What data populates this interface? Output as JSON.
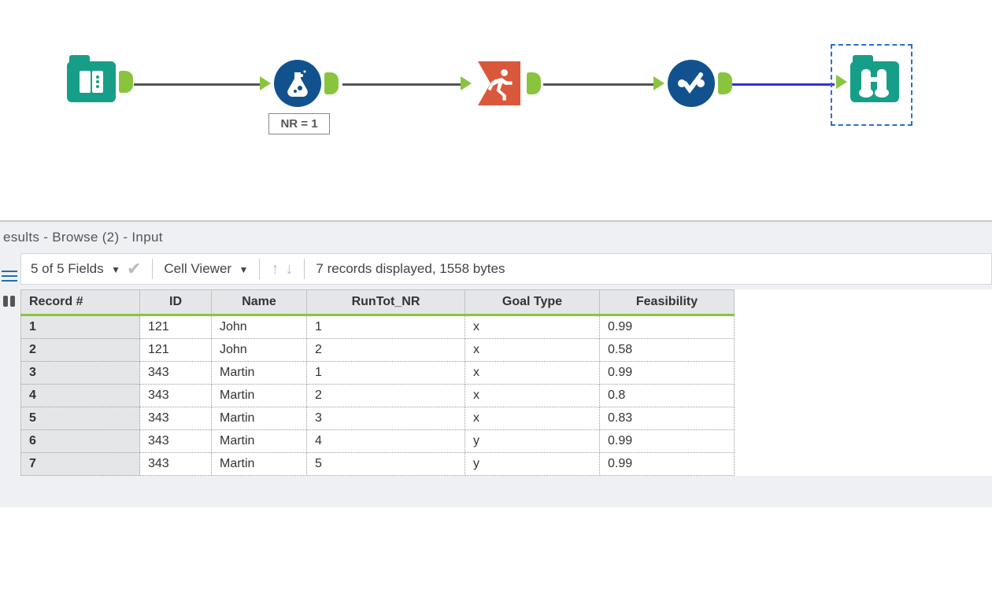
{
  "workflow": {
    "nodes": [
      {
        "name": "input-tool",
        "label": null
      },
      {
        "name": "formula-tool",
        "label": "NR = 1"
      },
      {
        "name": "running-total-tool",
        "label": null
      },
      {
        "name": "select-tool",
        "label": null
      },
      {
        "name": "browse-tool",
        "label": null
      }
    ]
  },
  "results": {
    "title": "esults - Browse (2) - Input",
    "toolbar": {
      "fields_label": "5 of 5 Fields",
      "cell_viewer_label": "Cell Viewer",
      "status": "7 records displayed, 1558 bytes"
    },
    "columns": [
      "Record #",
      "ID",
      "Name",
      "RunTot_NR",
      "Goal Type",
      "Feasibility"
    ],
    "rows": [
      {
        "rec": "1",
        "ID": "121",
        "Name": "John",
        "RunTot_NR": "1",
        "GoalType": "x",
        "Feasibility": "0.99"
      },
      {
        "rec": "2",
        "ID": "121",
        "Name": "John",
        "RunTot_NR": "2",
        "GoalType": "x",
        "Feasibility": "0.58"
      },
      {
        "rec": "3",
        "ID": "343",
        "Name": "Martin",
        "RunTot_NR": "1",
        "GoalType": "x",
        "Feasibility": "0.99"
      },
      {
        "rec": "4",
        "ID": "343",
        "Name": "Martin",
        "RunTot_NR": "2",
        "GoalType": "x",
        "Feasibility": "0.8"
      },
      {
        "rec": "5",
        "ID": "343",
        "Name": "Martin",
        "RunTot_NR": "3",
        "GoalType": "x",
        "Feasibility": "0.83"
      },
      {
        "rec": "6",
        "ID": "343",
        "Name": "Martin",
        "RunTot_NR": "4",
        "GoalType": "y",
        "Feasibility": "0.99"
      },
      {
        "rec": "7",
        "ID": "343",
        "Name": "Martin",
        "RunTot_NR": "5",
        "GoalType": "y",
        "Feasibility": "0.99"
      }
    ]
  }
}
